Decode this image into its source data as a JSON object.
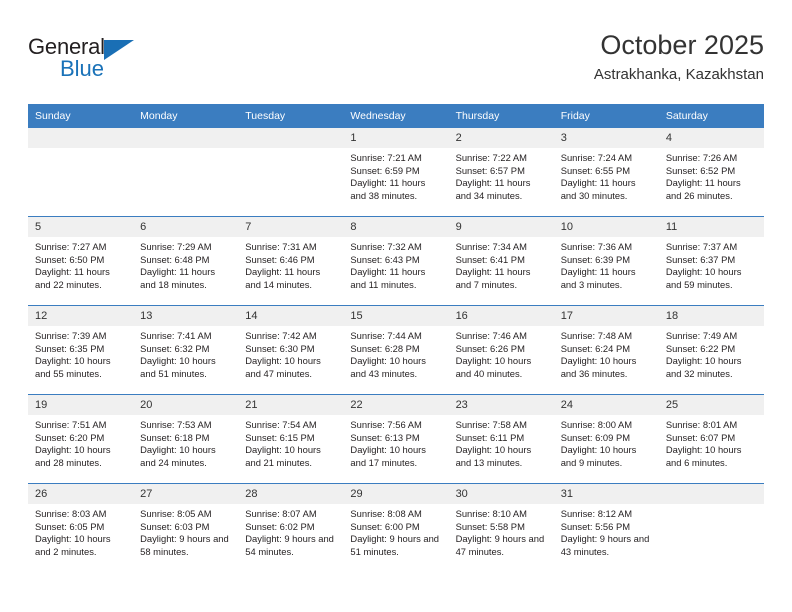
{
  "brand": {
    "name_part1": "General",
    "name_part2": "Blue",
    "triangle_icon": "triangle-icon",
    "accent_color": "#1a72b8"
  },
  "header": {
    "title": "October 2025",
    "subtitle": "Astrakhanka, Kazakhstan"
  },
  "calendar": {
    "header_bg": "#3b7dc0",
    "daynum_bg": "#f0f0f0",
    "weekday_headers": [
      "Sunday",
      "Monday",
      "Tuesday",
      "Wednesday",
      "Thursday",
      "Friday",
      "Saturday"
    ],
    "labels": {
      "sunrise": "Sunrise:",
      "sunset": "Sunset:",
      "daylight": "Daylight:"
    },
    "weeks": [
      [
        {
          "day": "",
          "sunrise": "",
          "sunset": "",
          "daylight": ""
        },
        {
          "day": "",
          "sunrise": "",
          "sunset": "",
          "daylight": ""
        },
        {
          "day": "",
          "sunrise": "",
          "sunset": "",
          "daylight": ""
        },
        {
          "day": "1",
          "sunrise": "Sunrise: 7:21 AM",
          "sunset": "Sunset: 6:59 PM",
          "daylight": "Daylight: 11 hours and 38 minutes."
        },
        {
          "day": "2",
          "sunrise": "Sunrise: 7:22 AM",
          "sunset": "Sunset: 6:57 PM",
          "daylight": "Daylight: 11 hours and 34 minutes."
        },
        {
          "day": "3",
          "sunrise": "Sunrise: 7:24 AM",
          "sunset": "Sunset: 6:55 PM",
          "daylight": "Daylight: 11 hours and 30 minutes."
        },
        {
          "day": "4",
          "sunrise": "Sunrise: 7:26 AM",
          "sunset": "Sunset: 6:52 PM",
          "daylight": "Daylight: 11 hours and 26 minutes."
        }
      ],
      [
        {
          "day": "5",
          "sunrise": "Sunrise: 7:27 AM",
          "sunset": "Sunset: 6:50 PM",
          "daylight": "Daylight: 11 hours and 22 minutes."
        },
        {
          "day": "6",
          "sunrise": "Sunrise: 7:29 AM",
          "sunset": "Sunset: 6:48 PM",
          "daylight": "Daylight: 11 hours and 18 minutes."
        },
        {
          "day": "7",
          "sunrise": "Sunrise: 7:31 AM",
          "sunset": "Sunset: 6:46 PM",
          "daylight": "Daylight: 11 hours and 14 minutes."
        },
        {
          "day": "8",
          "sunrise": "Sunrise: 7:32 AM",
          "sunset": "Sunset: 6:43 PM",
          "daylight": "Daylight: 11 hours and 11 minutes."
        },
        {
          "day": "9",
          "sunrise": "Sunrise: 7:34 AM",
          "sunset": "Sunset: 6:41 PM",
          "daylight": "Daylight: 11 hours and 7 minutes."
        },
        {
          "day": "10",
          "sunrise": "Sunrise: 7:36 AM",
          "sunset": "Sunset: 6:39 PM",
          "daylight": "Daylight: 11 hours and 3 minutes."
        },
        {
          "day": "11",
          "sunrise": "Sunrise: 7:37 AM",
          "sunset": "Sunset: 6:37 PM",
          "daylight": "Daylight: 10 hours and 59 minutes."
        }
      ],
      [
        {
          "day": "12",
          "sunrise": "Sunrise: 7:39 AM",
          "sunset": "Sunset: 6:35 PM",
          "daylight": "Daylight: 10 hours and 55 minutes."
        },
        {
          "day": "13",
          "sunrise": "Sunrise: 7:41 AM",
          "sunset": "Sunset: 6:32 PM",
          "daylight": "Daylight: 10 hours and 51 minutes."
        },
        {
          "day": "14",
          "sunrise": "Sunrise: 7:42 AM",
          "sunset": "Sunset: 6:30 PM",
          "daylight": "Daylight: 10 hours and 47 minutes."
        },
        {
          "day": "15",
          "sunrise": "Sunrise: 7:44 AM",
          "sunset": "Sunset: 6:28 PM",
          "daylight": "Daylight: 10 hours and 43 minutes."
        },
        {
          "day": "16",
          "sunrise": "Sunrise: 7:46 AM",
          "sunset": "Sunset: 6:26 PM",
          "daylight": "Daylight: 10 hours and 40 minutes."
        },
        {
          "day": "17",
          "sunrise": "Sunrise: 7:48 AM",
          "sunset": "Sunset: 6:24 PM",
          "daylight": "Daylight: 10 hours and 36 minutes."
        },
        {
          "day": "18",
          "sunrise": "Sunrise: 7:49 AM",
          "sunset": "Sunset: 6:22 PM",
          "daylight": "Daylight: 10 hours and 32 minutes."
        }
      ],
      [
        {
          "day": "19",
          "sunrise": "Sunrise: 7:51 AM",
          "sunset": "Sunset: 6:20 PM",
          "daylight": "Daylight: 10 hours and 28 minutes."
        },
        {
          "day": "20",
          "sunrise": "Sunrise: 7:53 AM",
          "sunset": "Sunset: 6:18 PM",
          "daylight": "Daylight: 10 hours and 24 minutes."
        },
        {
          "day": "21",
          "sunrise": "Sunrise: 7:54 AM",
          "sunset": "Sunset: 6:15 PM",
          "daylight": "Daylight: 10 hours and 21 minutes."
        },
        {
          "day": "22",
          "sunrise": "Sunrise: 7:56 AM",
          "sunset": "Sunset: 6:13 PM",
          "daylight": "Daylight: 10 hours and 17 minutes."
        },
        {
          "day": "23",
          "sunrise": "Sunrise: 7:58 AM",
          "sunset": "Sunset: 6:11 PM",
          "daylight": "Daylight: 10 hours and 13 minutes."
        },
        {
          "day": "24",
          "sunrise": "Sunrise: 8:00 AM",
          "sunset": "Sunset: 6:09 PM",
          "daylight": "Daylight: 10 hours and 9 minutes."
        },
        {
          "day": "25",
          "sunrise": "Sunrise: 8:01 AM",
          "sunset": "Sunset: 6:07 PM",
          "daylight": "Daylight: 10 hours and 6 minutes."
        }
      ],
      [
        {
          "day": "26",
          "sunrise": "Sunrise: 8:03 AM",
          "sunset": "Sunset: 6:05 PM",
          "daylight": "Daylight: 10 hours and 2 minutes."
        },
        {
          "day": "27",
          "sunrise": "Sunrise: 8:05 AM",
          "sunset": "Sunset: 6:03 PM",
          "daylight": "Daylight: 9 hours and 58 minutes."
        },
        {
          "day": "28",
          "sunrise": "Sunrise: 8:07 AM",
          "sunset": "Sunset: 6:02 PM",
          "daylight": "Daylight: 9 hours and 54 minutes."
        },
        {
          "day": "29",
          "sunrise": "Sunrise: 8:08 AM",
          "sunset": "Sunset: 6:00 PM",
          "daylight": "Daylight: 9 hours and 51 minutes."
        },
        {
          "day": "30",
          "sunrise": "Sunrise: 8:10 AM",
          "sunset": "Sunset: 5:58 PM",
          "daylight": "Daylight: 9 hours and 47 minutes."
        },
        {
          "day": "31",
          "sunrise": "Sunrise: 8:12 AM",
          "sunset": "Sunset: 5:56 PM",
          "daylight": "Daylight: 9 hours and 43 minutes."
        },
        {
          "day": "",
          "sunrise": "",
          "sunset": "",
          "daylight": ""
        }
      ]
    ]
  }
}
